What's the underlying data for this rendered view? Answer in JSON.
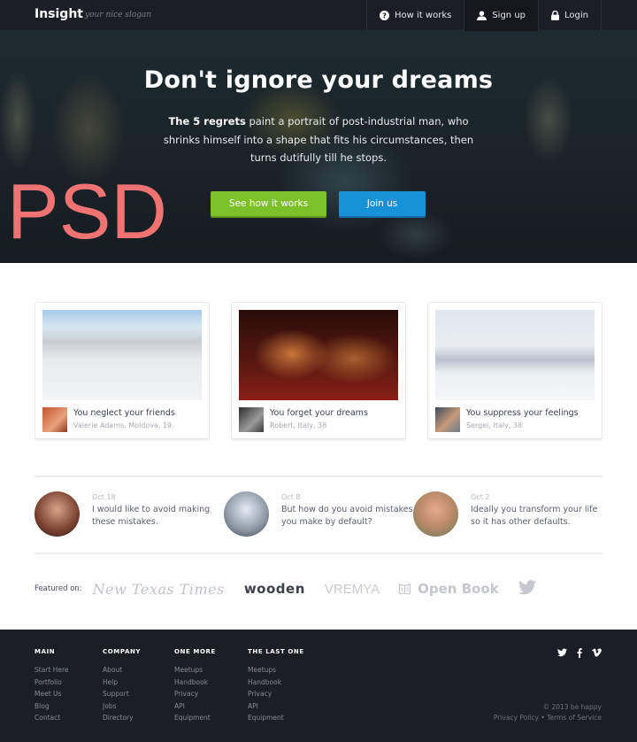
{
  "nav": {
    "brand": "Insight",
    "slogan": "your nice slogan",
    "items": [
      {
        "label": "How it works",
        "icon": "question-circle-icon"
      },
      {
        "label": "Sign up",
        "icon": "user-icon"
      },
      {
        "label": "Login",
        "icon": "lock-icon"
      }
    ]
  },
  "hero": {
    "title": "Don't ignore your dreams",
    "text_bold": "The 5 regrets",
    "text_rest": " paint a portrait of post-industrial man, who shrinks himself into a shape that fits his circumstances, then turns dutifully till he stops.",
    "primary_button": "See how it works",
    "secondary_button": "Join us",
    "watermark": "PSD",
    "colors": {
      "primary": "#7dc12a",
      "secondary": "#1792d9",
      "watermark": "#f07373"
    }
  },
  "cards": [
    {
      "title": "You neglect your friends",
      "subtitle": "Valerie Adams, Moldova, 19.",
      "image": "skatepark-photo"
    },
    {
      "title": "You forget your dreams",
      "subtitle": "Robert, Italy, 38",
      "image": "city-loft-sign-photo"
    },
    {
      "title": "You suppress your feelings",
      "subtitle": "Sergei, Italy, 38",
      "image": "street-photo"
    }
  ],
  "quotes": [
    {
      "date": "Oct 18",
      "text": "I would like to avoid making these mistakes."
    },
    {
      "date": "Oct 8",
      "text": "But how do you avoid mistakes you make by default?"
    },
    {
      "date": "Oct 2",
      "text": "Ideally you transform your life so it has other defaults."
    }
  ],
  "featured": {
    "label": "Featured on:",
    "logos": [
      "New Texas Times",
      "wooden",
      "VREMYA",
      "Open Book",
      "twitter"
    ]
  },
  "footer": {
    "columns": [
      {
        "heading": "MAIN",
        "links": [
          "Start Here",
          "Portfolio",
          "Meet Us",
          "Blog",
          "Contact"
        ]
      },
      {
        "heading": "COMPANY",
        "links": [
          "About",
          "Help",
          "Support",
          "Jobs",
          "Directory"
        ]
      },
      {
        "heading": "ONE MORE",
        "links": [
          "Meetups",
          "Handbook",
          "Privacy",
          "API",
          "Equipment"
        ]
      },
      {
        "heading": "THE LAST ONE",
        "links": [
          "Meetups",
          "Handbook",
          "Privacy",
          "API",
          "Equipment"
        ]
      }
    ],
    "social": [
      "twitter",
      "facebook",
      "vimeo"
    ],
    "copyright": "© 2013 be happy",
    "privacy": "Privacy Policy",
    "separator": "•",
    "terms": "Terms of Service"
  }
}
